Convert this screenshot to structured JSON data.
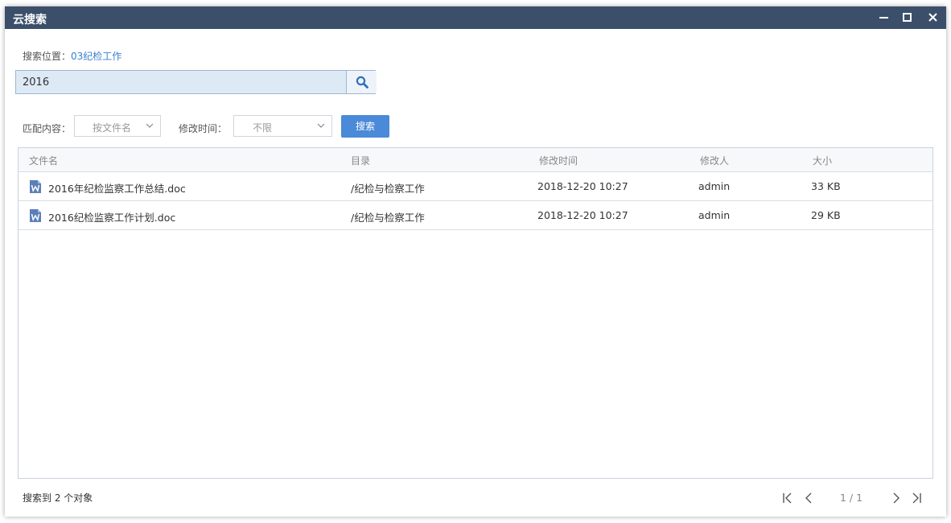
{
  "window": {
    "title": "云搜索"
  },
  "location": {
    "label": "搜索位置：",
    "folder": "03纪检工作"
  },
  "search": {
    "value": "2016"
  },
  "filters": {
    "match_label": "匹配内容：",
    "match_value": "按文件名",
    "time_label": "修改时间：",
    "time_value": "不限",
    "search_button": "搜索"
  },
  "table": {
    "columns": [
      "文件名",
      "目录",
      "修改时间",
      "修改人",
      "大小"
    ],
    "rows": [
      {
        "name": "2016年纪检监察工作总结.doc",
        "dir": "/纪检与检察工作",
        "time": "2018-12-20 10:27",
        "user": "admin",
        "size": "33 KB",
        "icon": "word-doc-icon"
      },
      {
        "name": "2016纪检监察工作计划.doc",
        "dir": "/纪检与检察工作",
        "time": "2018-12-20 10:27",
        "user": "admin",
        "size": "29 KB",
        "icon": "word-doc-icon"
      }
    ]
  },
  "footer": {
    "count_text": "搜索到 2 个对象",
    "page_text": "1 / 1"
  },
  "colors": {
    "titlebar": "#3b4f6b",
    "accent": "#4a8ad8",
    "link": "#3a80d0",
    "search_bg": "#dde9f5"
  }
}
